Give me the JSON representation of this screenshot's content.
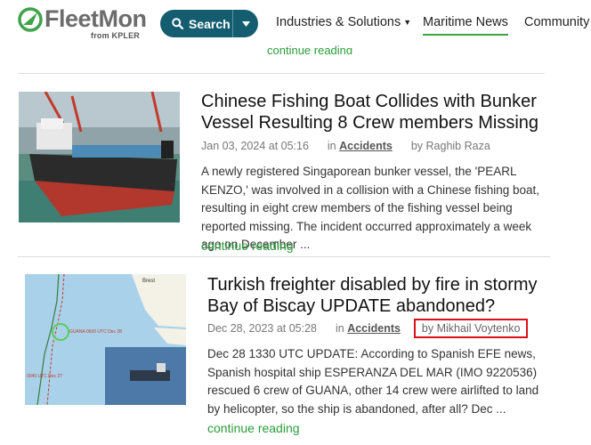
{
  "header": {
    "logo_text": "FleetMon",
    "logo_sub": "from KPLER",
    "search_label": "Search",
    "nav": [
      {
        "label": "Industries & Solutions",
        "has_dropdown": true
      },
      {
        "label": "Maritime News",
        "active": true
      },
      {
        "label": "Community",
        "has_dropdown": true
      }
    ]
  },
  "colors": {
    "brand_green": "#3fa34a",
    "search_bg": "#145d71",
    "link_green": "#2a9c3a",
    "highlight_red": "#d9101b"
  },
  "articles": [
    {
      "title": "Chinese Fishing Boat Collides with Bunker Vessel Resulting 8 Crew members Missing",
      "date": "Jan 03, 2024 at 05:16",
      "in": "in",
      "category": "Accidents",
      "author": "by Raghib Raza",
      "excerpt": "A newly registered Singaporean bunker vessel, the 'PEARL KENZO,' was involved in a collision with a Chinese fishing boat, resulting in eight crew members of the fishing vessel being reported missing. The incident occurred approximately a week ago on December ...",
      "continue": "continue reading"
    },
    {
      "title": "Turkish freighter disabled by fire in stormy Bay of Biscay UPDATE abandoned?",
      "date": "Dec 28, 2023 at 05:28",
      "in": "in",
      "category": "Accidents",
      "author": "by Mikhail Voytenko",
      "excerpt": "Dec 28 1330 UTC UPDATE: According to Spanish EFE news, Spanish hospital ship ESPERANZA DEL MAR (IMO 9220536) rescued 6 crew of GUANA, other 14 crew were airlifted to land by helicopter, so the ship is abandoned, after all? Dec ...",
      "continue": "continue reading",
      "map_labels": {
        "city": "Brest",
        "pos1": "GUANA 0600 UTC Dec 28",
        "pos2": "0040 UTC Dec 27"
      }
    }
  ]
}
